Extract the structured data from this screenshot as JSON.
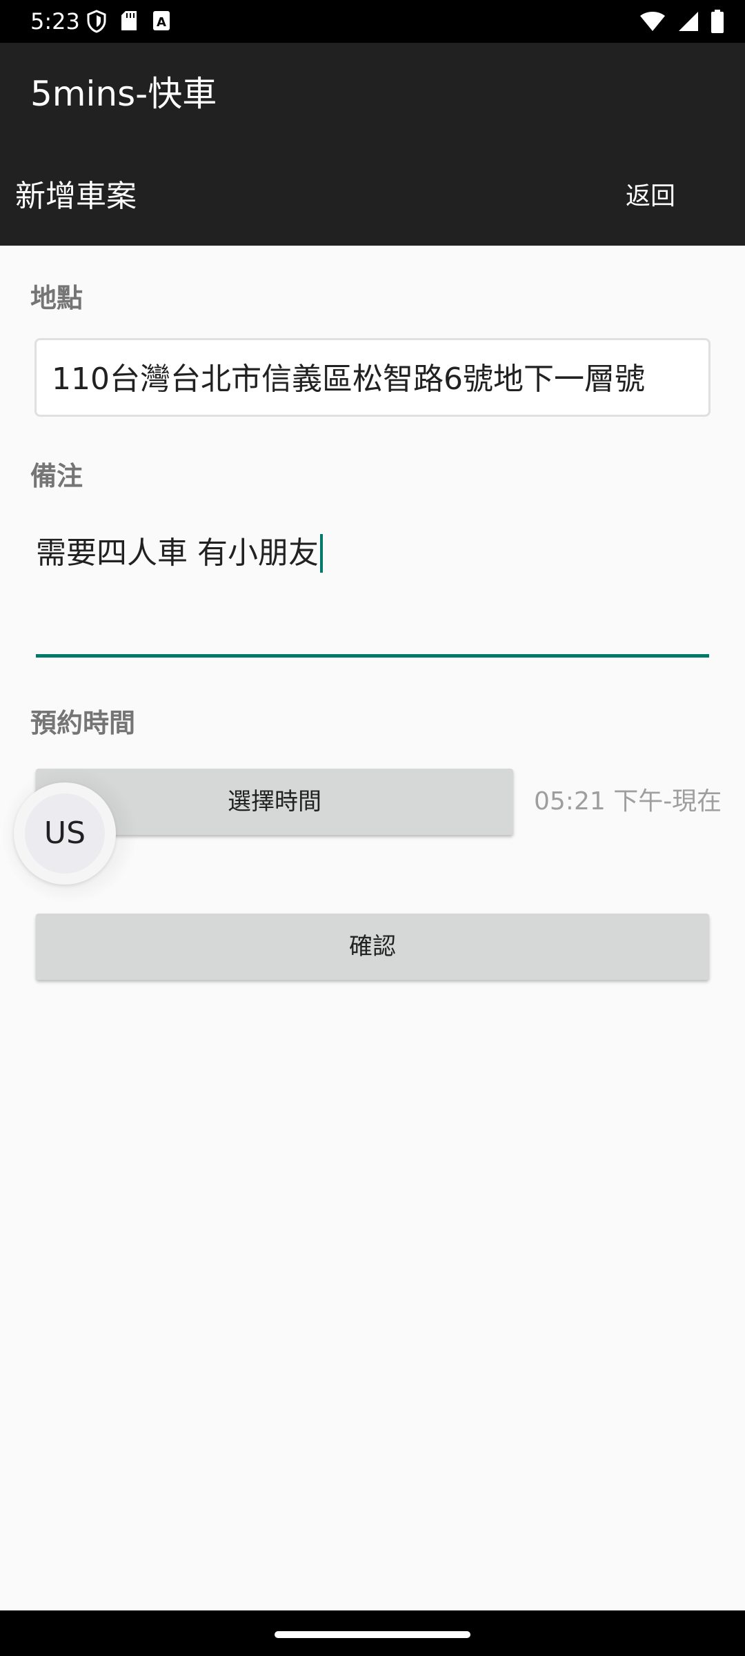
{
  "status_bar": {
    "time": "5:23",
    "left_icons": [
      "shield-icon",
      "sd-card-icon",
      "keyboard-a-icon"
    ],
    "right_icons": [
      "wifi-icon",
      "cell-signal-icon",
      "battery-icon"
    ]
  },
  "app_bar": {
    "app_title": "5mins-快車",
    "page_title": "新增車案",
    "back_label": "返回"
  },
  "form": {
    "location_label": "地點",
    "location_value": "110台灣台北市信義區松智路6號地下一層號",
    "note_label": "備注",
    "note_value": "需要四人車 有小朋友",
    "time_label": "預約時間",
    "select_time_label": "選擇時間",
    "time_value": "05:21 下午-現在",
    "confirm_label": "確認"
  },
  "floating_bubble": {
    "label": "US"
  },
  "colors": {
    "app_bar": "#212121",
    "accent": "#00796b",
    "button_bg": "#d6d7d7",
    "background": "#fafafa"
  }
}
